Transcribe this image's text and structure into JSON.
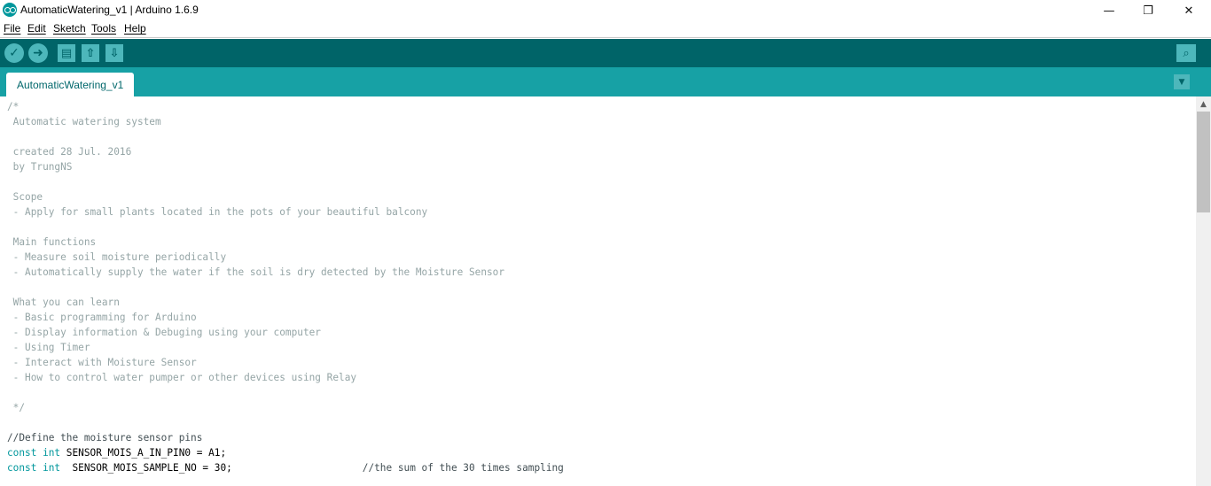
{
  "window": {
    "title": "AutomaticWatering_v1 | Arduino 1.6.9",
    "icon": "arduino-logo-icon",
    "controls": {
      "minimize": "—",
      "maximize": "❐",
      "close": "✕"
    }
  },
  "menu": {
    "items": [
      "File",
      "Edit",
      "Sketch",
      "Tools",
      "Help"
    ]
  },
  "toolbar": {
    "verify_icon": "✓",
    "upload_icon": "➜",
    "new_icon": "▤",
    "open_icon": "⇧",
    "save_icon": "⇩",
    "serial_monitor_icon": "⌕"
  },
  "tabs": {
    "active": "AutomaticWatering_v1",
    "menu_icon": "▼"
  },
  "scrollbar": {
    "up_icon": "▲"
  },
  "colors": {
    "toolbar": "#006468",
    "tabstrip": "#17a1a5",
    "comment": "#95a5a6",
    "keyword": "#00979c"
  },
  "code": {
    "l1": "/*",
    "l2": " Automatic watering system",
    "l3": "",
    "l4": " created 28 Jul. 2016",
    "l5": " by TrungNS",
    "l6": "",
    "l7": " Scope",
    "l8": " - Apply for small plants located in the pots of your beautiful balcony",
    "l9": "",
    "l10": " Main functions",
    "l11": " - Measure soil moisture periodically",
    "l12": " - Automatically supply the water if the soil is dry detected by the Moisture Sensor",
    "l13": "",
    "l14": " What you can learn",
    "l15": " - Basic programming for Arduino",
    "l16": " - Display information & Debuging using your computer",
    "l17": " - Using Timer",
    "l18": " - Interact with Moisture Sensor",
    "l19": " - How to control water pumper or other devices using Relay",
    "l20": "",
    "l21": " */",
    "l22": "",
    "l23": "//Define the moisture sensor pins",
    "l24_kw": "const int",
    "l24_rest": " SENSOR_MOIS_A_IN_PIN0 = A1;",
    "l25_kw": "const int",
    "l25_rest": "  SENSOR_MOIS_SAMPLE_NO = 30;                      ",
    "l25_comment": "//the sum of the 30 times sampling"
  }
}
